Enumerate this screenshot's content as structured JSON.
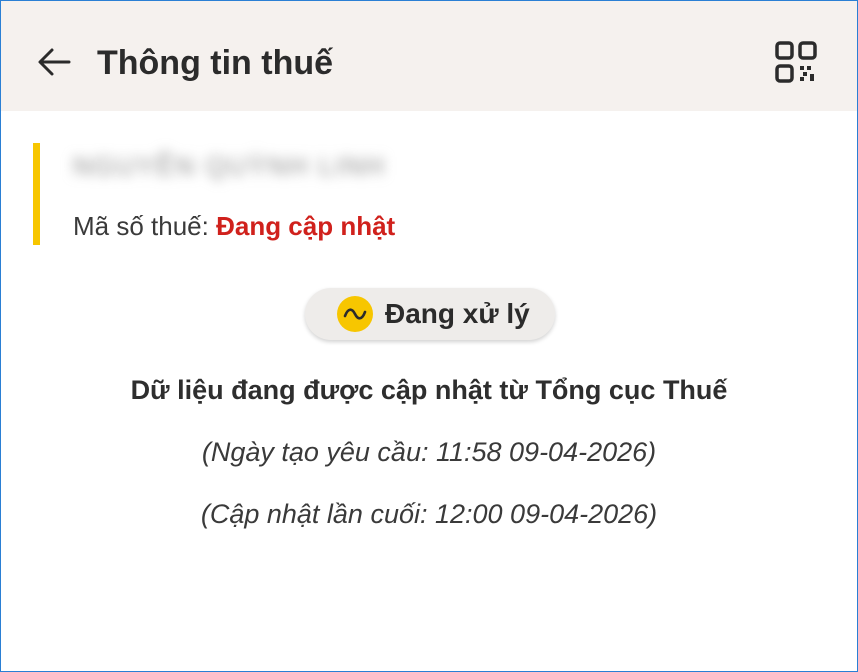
{
  "header": {
    "title": "Thông tin thuế",
    "back_icon": "arrow-left-icon",
    "qr_icon": "qr-code-icon"
  },
  "taxpayer": {
    "name": "NGUYỄN QUỲNH LINH",
    "tax_code_label": "Mã số thuế: ",
    "tax_code_value": "Đang cập nhật",
    "accent_color": "#f7c600"
  },
  "status": {
    "icon": "wave-icon",
    "label": "Đang xử lý"
  },
  "message": "Dữ liệu đang được cập nhật từ Tổng cục Thuế",
  "request_time": "(Ngày tạo yêu cầu: 11:58 09-04-2026)",
  "last_update": "(Cập nhật lần cuối: 12:00 09-04-2026)"
}
